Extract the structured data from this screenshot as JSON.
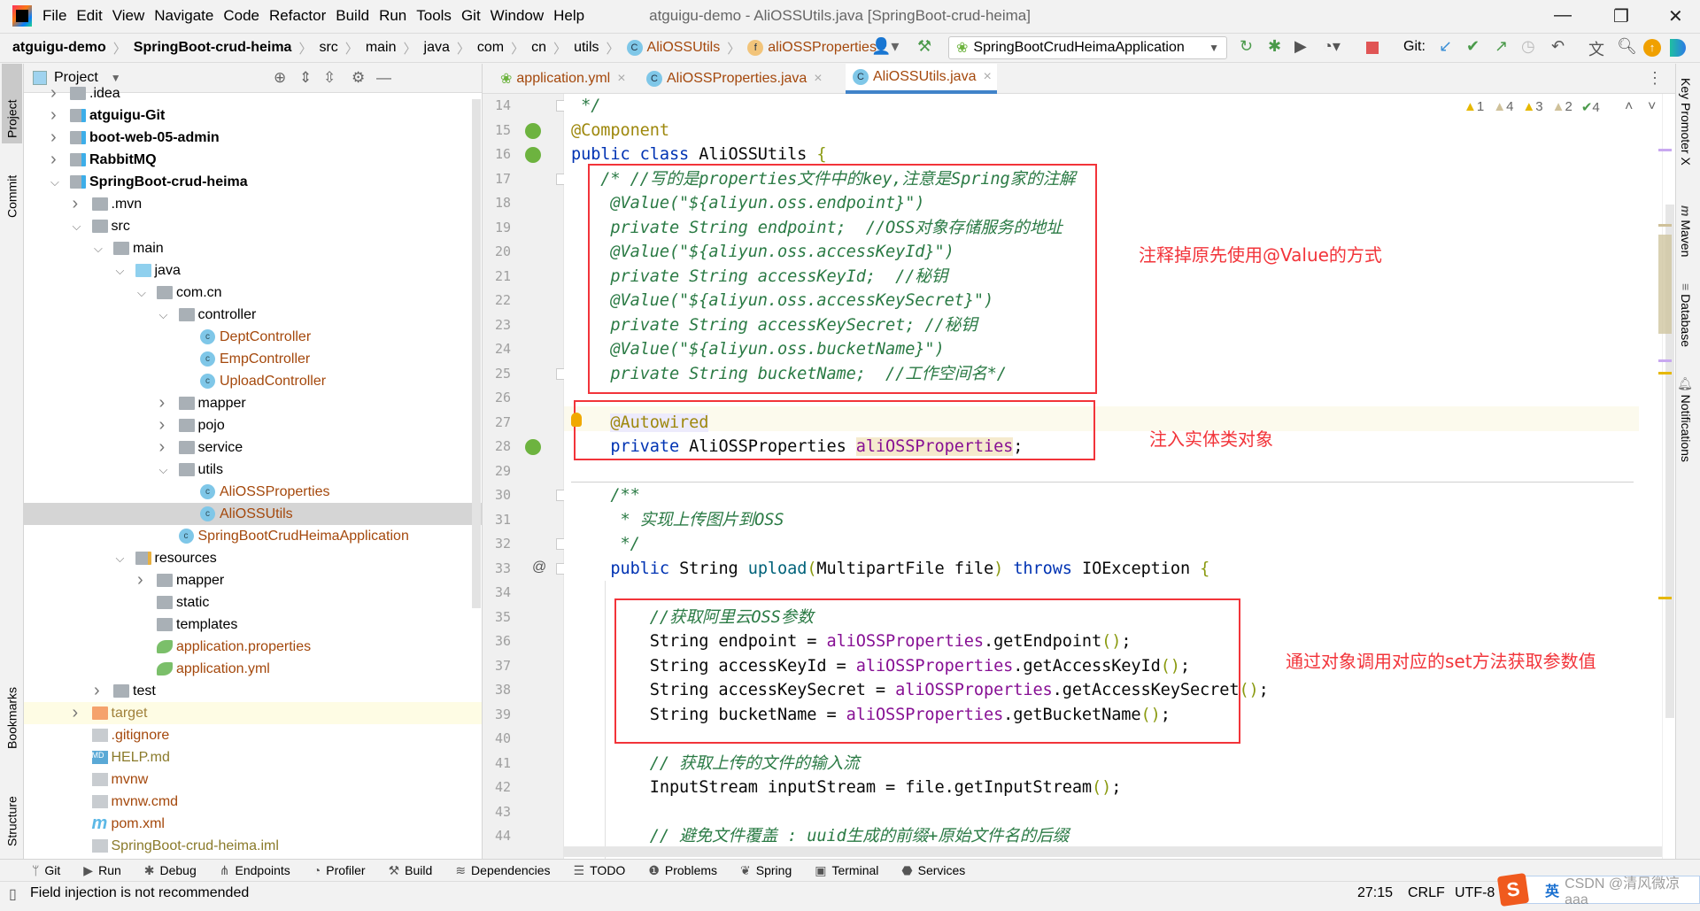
{
  "menubar": {
    "items": [
      "File",
      "Edit",
      "View",
      "Navigate",
      "Code",
      "Refactor",
      "Build",
      "Run",
      "Tools",
      "Git",
      "Window",
      "Help"
    ],
    "window_title": "atguigu-demo - AliOSSUtils.java [SpringBoot-crud-heima]"
  },
  "breadcrumb": [
    {
      "label": "atguigu-demo",
      "bold": true
    },
    {
      "label": "SpringBoot-crud-heima",
      "bold": true
    },
    {
      "label": "src"
    },
    {
      "label": "main"
    },
    {
      "label": "java"
    },
    {
      "label": "com"
    },
    {
      "label": "cn"
    },
    {
      "label": "utils"
    },
    {
      "label": "AliOSSUtils",
      "icon": "class-icon"
    },
    {
      "label": "aliOSSProperties",
      "icon": "field-icon"
    }
  ],
  "toolbar": {
    "run_config": "SpringBootCrudHeimaApplication",
    "git_label": "Git:"
  },
  "project_panel": {
    "title": "Project"
  },
  "tree": [
    {
      "label": ".idea",
      "level": 0,
      "type": "folder",
      "arrow": "closed",
      "style": "plain"
    },
    {
      "label": "atguigu-Git",
      "level": 0,
      "type": "module",
      "arrow": "closed",
      "style": "bold"
    },
    {
      "label": "boot-web-05-admin",
      "level": 0,
      "type": "module",
      "arrow": "closed",
      "style": "bold"
    },
    {
      "label": "RabbitMQ",
      "level": 0,
      "type": "module",
      "arrow": "closed",
      "style": "bold"
    },
    {
      "label": "SpringBoot-crud-heima",
      "level": 0,
      "type": "module",
      "arrow": "open",
      "style": "bold"
    },
    {
      "label": ".mvn",
      "level": 1,
      "type": "folder",
      "arrow": "closed",
      "style": "plain"
    },
    {
      "label": "src",
      "level": 1,
      "type": "folder",
      "arrow": "open",
      "style": "plain"
    },
    {
      "label": "main",
      "level": 2,
      "type": "folder",
      "arrow": "open",
      "style": "plain"
    },
    {
      "label": "java",
      "level": 3,
      "type": "source-folder",
      "arrow": "open",
      "style": "plain"
    },
    {
      "label": "com.cn",
      "level": 4,
      "type": "package",
      "arrow": "open",
      "style": "plain"
    },
    {
      "label": "controller",
      "level": 5,
      "type": "package",
      "arrow": "open",
      "style": "plain"
    },
    {
      "label": "DeptController",
      "level": 6,
      "type": "class",
      "style": "modified"
    },
    {
      "label": "EmpController",
      "level": 6,
      "type": "class",
      "style": "modified"
    },
    {
      "label": "UploadController",
      "level": 6,
      "type": "class",
      "style": "modified"
    },
    {
      "label": "mapper",
      "level": 5,
      "type": "package",
      "arrow": "closed",
      "style": "plain"
    },
    {
      "label": "pojo",
      "level": 5,
      "type": "package",
      "arrow": "closed",
      "style": "plain"
    },
    {
      "label": "service",
      "level": 5,
      "type": "package",
      "arrow": "closed",
      "style": "plain"
    },
    {
      "label": "utils",
      "level": 5,
      "type": "package",
      "arrow": "open",
      "style": "plain"
    },
    {
      "label": "AliOSSProperties",
      "level": 6,
      "type": "class",
      "style": "modified"
    },
    {
      "label": "AliOSSUtils",
      "level": 6,
      "type": "class",
      "style": "modified",
      "selected": true
    },
    {
      "label": "SpringBootCrudHeimaApplication",
      "level": 5,
      "type": "spring-class",
      "style": "modified"
    },
    {
      "label": "resources",
      "level": 3,
      "type": "resource-folder",
      "arrow": "open",
      "style": "plain"
    },
    {
      "label": "mapper",
      "level": 4,
      "type": "folder",
      "arrow": "closed",
      "style": "plain"
    },
    {
      "label": "static",
      "level": 4,
      "type": "folder",
      "style": "plain"
    },
    {
      "label": "templates",
      "level": 4,
      "type": "folder",
      "style": "plain"
    },
    {
      "label": "application.properties",
      "level": 4,
      "type": "spring-config",
      "style": "modified"
    },
    {
      "label": "application.yml",
      "level": 4,
      "type": "spring-config",
      "style": "modified"
    },
    {
      "label": "test",
      "level": 2,
      "type": "folder",
      "arrow": "closed",
      "style": "plain"
    },
    {
      "label": "target",
      "level": 1,
      "type": "excluded-folder",
      "arrow": "closed",
      "style": "excluded"
    },
    {
      "label": ".gitignore",
      "level": 1,
      "type": "file",
      "style": "modified"
    },
    {
      "label": "HELP.md",
      "level": 1,
      "type": "markdown",
      "style": "unversioned"
    },
    {
      "label": "mvnw",
      "level": 1,
      "type": "script",
      "style": "modified"
    },
    {
      "label": "mvnw.cmd",
      "level": 1,
      "type": "file",
      "style": "modified"
    },
    {
      "label": "pom.xml",
      "level": 1,
      "type": "maven",
      "style": "modified"
    },
    {
      "label": "SpringBoot-crud-heima.iml",
      "level": 1,
      "type": "file",
      "style": "unversioned"
    }
  ],
  "tabs": [
    {
      "label": "application.yml",
      "icon": "spring-config-icon"
    },
    {
      "label": "AliOSSProperties.java",
      "icon": "class-icon"
    },
    {
      "label": "AliOSSUtils.java",
      "icon": "class-icon",
      "active": true
    }
  ],
  "inspections": [
    {
      "icon": "warning-icon",
      "count": "1",
      "color": "#e6b800"
    },
    {
      "icon": "weak-warning-icon",
      "count": "4",
      "color": "#cfc19a"
    },
    {
      "icon": "warning-icon",
      "count": "3",
      "color": "#e6b800"
    },
    {
      "icon": "weak-warning-icon",
      "count": "2",
      "color": "#cfc19a"
    },
    {
      "icon": "typo-icon",
      "count": "4",
      "color": "#4a9a4a"
    }
  ],
  "code": [
    {
      "n": "14",
      "tokens": [
        [
          "c",
          " */"
        ]
      ]
    },
    {
      "n": "15",
      "tokens": [
        [
          "a",
          "@Component"
        ]
      ]
    },
    {
      "n": "16",
      "tokens": [
        [
          "k",
          "public class "
        ],
        [
          "t",
          "AliOSSUtils "
        ],
        [
          "p",
          "{"
        ]
      ]
    },
    {
      "n": "17",
      "tokens": [
        [
          "c",
          "   /* //写的是properties文件中的key,注意是Spring家的注解"
        ]
      ]
    },
    {
      "n": "18",
      "tokens": [
        [
          "c",
          "    @Value(\"${aliyun.oss.endpoint}\")"
        ]
      ]
    },
    {
      "n": "19",
      "tokens": [
        [
          "c",
          "    private String endpoint;  //OSS对象存储服务的地址"
        ]
      ]
    },
    {
      "n": "20",
      "tokens": [
        [
          "c",
          "    @Value(\"${aliyun.oss.accessKeyId}\")"
        ]
      ]
    },
    {
      "n": "21",
      "tokens": [
        [
          "c",
          "    private String accessKeyId;  //秘钥"
        ]
      ]
    },
    {
      "n": "22",
      "tokens": [
        [
          "c",
          "    @Value(\"${aliyun.oss.accessKeySecret}\")"
        ]
      ]
    },
    {
      "n": "23",
      "tokens": [
        [
          "c",
          "    private String accessKeySecret; //秘钥"
        ]
      ]
    },
    {
      "n": "24",
      "tokens": [
        [
          "c",
          "    @Value(\"${aliyun.oss.bucketName}\")"
        ]
      ]
    },
    {
      "n": "25",
      "tokens": [
        [
          "c",
          "    private String bucketName;  //工作空间名*/"
        ]
      ]
    },
    {
      "n": "26",
      "tokens": []
    },
    {
      "n": "27",
      "tokens": [
        [
          "t",
          "    "
        ],
        [
          "ah",
          "@Autowired"
        ]
      ],
      "caret": true
    },
    {
      "n": "28",
      "tokens": [
        [
          "t",
          "    "
        ],
        [
          "k",
          "private "
        ],
        [
          "t",
          "AliOSSProperties "
        ],
        [
          "fh",
          "aliOSSProperties"
        ],
        [
          "t",
          ";"
        ]
      ]
    },
    {
      "n": "29",
      "tokens": []
    },
    {
      "n": "30",
      "tokens": [
        [
          "c",
          "    /**"
        ]
      ]
    },
    {
      "n": "31",
      "tokens": [
        [
          "c",
          "     * 实现上传图片到OSS"
        ]
      ]
    },
    {
      "n": "32",
      "tokens": [
        [
          "c",
          "     */"
        ]
      ]
    },
    {
      "n": "33",
      "tokens": [
        [
          "t",
          "    "
        ],
        [
          "k",
          "public "
        ],
        [
          "t",
          "String "
        ],
        [
          "m",
          "upload"
        ],
        [
          "p",
          "("
        ],
        [
          "t",
          "MultipartFile file"
        ],
        [
          "p",
          ")"
        ],
        [
          "k",
          " throws "
        ],
        [
          "t",
          "IOException "
        ],
        [
          "p",
          "{"
        ]
      ]
    },
    {
      "n": "34",
      "tokens": []
    },
    {
      "n": "35",
      "tokens": [
        [
          "c",
          "        //获取阿里云OSS参数"
        ]
      ]
    },
    {
      "n": "36",
      "tokens": [
        [
          "t",
          "        String endpoint = "
        ],
        [
          "f",
          "aliOSSProperties"
        ],
        [
          "t",
          ".getEndpoint"
        ],
        [
          "p",
          "()"
        ],
        [
          "t",
          ";"
        ]
      ]
    },
    {
      "n": "37",
      "tokens": [
        [
          "t",
          "        String accessKeyId = "
        ],
        [
          "f",
          "aliOSSProperties"
        ],
        [
          "t",
          ".getAccessKeyId"
        ],
        [
          "p",
          "()"
        ],
        [
          "t",
          ";"
        ]
      ]
    },
    {
      "n": "38",
      "tokens": [
        [
          "t",
          "        String accessKeySecret = "
        ],
        [
          "f",
          "aliOSSProperties"
        ],
        [
          "t",
          ".getAccessKeySecret"
        ],
        [
          "p",
          "()"
        ],
        [
          "t",
          ";"
        ]
      ]
    },
    {
      "n": "39",
      "tokens": [
        [
          "t",
          "        String bucketName = "
        ],
        [
          "f",
          "aliOSSProperties"
        ],
        [
          "t",
          ".getBucketName"
        ],
        [
          "p",
          "()"
        ],
        [
          "t",
          ";"
        ]
      ]
    },
    {
      "n": "40",
      "tokens": []
    },
    {
      "n": "41",
      "tokens": [
        [
          "c",
          "        // 获取上传的文件的输入流"
        ]
      ]
    },
    {
      "n": "42",
      "tokens": [
        [
          "t",
          "        InputStream inputStream = file.getInputStream"
        ],
        [
          "p",
          "()"
        ],
        [
          "t",
          ";"
        ]
      ]
    },
    {
      "n": "43",
      "tokens": []
    },
    {
      "n": "44",
      "tokens": [
        [
          "c",
          "        // 避免文件覆盖 : uuid生成的前缀+原始文件名的后缀"
        ]
      ]
    }
  ],
  "annotations": {
    "note1": "注释掉原先使用@Value的方式",
    "note2": "注入实体类对象",
    "note3": "通过对象调用对应的set方法获取参数值"
  },
  "left_stripe": [
    "Project",
    "Commit",
    "Bookmarks",
    "Structure"
  ],
  "right_stripe": [
    "Key Promoter X",
    "Maven",
    "Database",
    "Notifications"
  ],
  "bottom_tools": [
    {
      "label": "Git",
      "icon": "git-branch-icon"
    },
    {
      "label": "Run",
      "icon": "run-icon"
    },
    {
      "label": "Debug",
      "icon": "bug-icon"
    },
    {
      "label": "Endpoints",
      "icon": "endpoints-icon"
    },
    {
      "label": "Profiler",
      "icon": "profiler-icon"
    },
    {
      "label": "Build",
      "icon": "hammer-icon"
    },
    {
      "label": "Dependencies",
      "icon": "layers-icon"
    },
    {
      "label": "TODO",
      "icon": "list-icon"
    },
    {
      "label": "Problems",
      "icon": "problems-icon"
    },
    {
      "label": "Spring",
      "icon": "spring-leaf-icon"
    },
    {
      "label": "Terminal",
      "icon": "terminal-icon"
    },
    {
      "label": "Services",
      "icon": "services-icon"
    }
  ],
  "status": {
    "message": "Field injection is not recommended",
    "position": "27:15",
    "line_sep": "CRLF",
    "encoding": "UTF-8"
  },
  "overlay": {
    "ime_label": "英",
    "watermark": "CSDN @清风微凉 aaa"
  },
  "colors": {
    "accent": "#4083c9",
    "annotation_box": "#f2343a",
    "keyword": "#0033b3",
    "field": "#871094",
    "comment": "#2a7a44"
  }
}
